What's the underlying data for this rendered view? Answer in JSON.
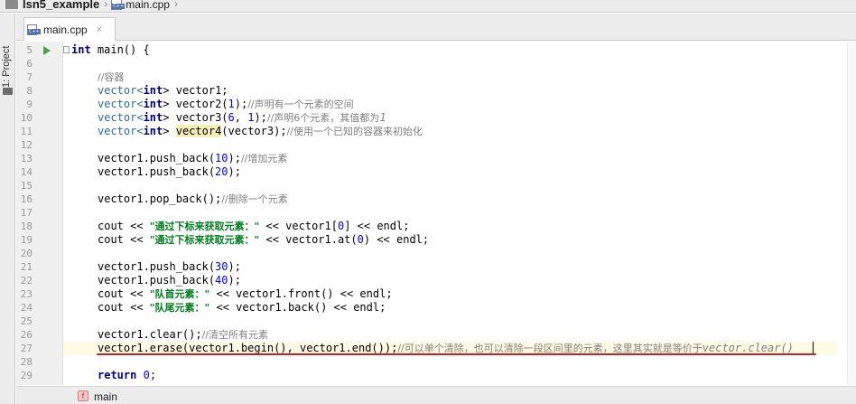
{
  "navbar": {
    "project": "lsn5_example",
    "file": "main.cpp",
    "file_icon_text": "C++"
  },
  "toolstrip": {
    "project_label": "1: Project"
  },
  "tab": {
    "label": "main.cpp",
    "icon_text": "C++",
    "close": "×"
  },
  "editor": {
    "lines": [
      {
        "n": "5"
      },
      {
        "n": "6"
      },
      {
        "n": "7"
      },
      {
        "n": "8"
      },
      {
        "n": "9"
      },
      {
        "n": "10"
      },
      {
        "n": "11"
      },
      {
        "n": "12"
      },
      {
        "n": "13"
      },
      {
        "n": "14"
      },
      {
        "n": "15"
      },
      {
        "n": "16"
      },
      {
        "n": "17"
      },
      {
        "n": "18"
      },
      {
        "n": "19"
      },
      {
        "n": "20"
      },
      {
        "n": "21"
      },
      {
        "n": "22"
      },
      {
        "n": "23"
      },
      {
        "n": "24"
      },
      {
        "n": "25"
      },
      {
        "n": "26"
      },
      {
        "n": "27"
      },
      {
        "n": "28"
      },
      {
        "n": "29"
      }
    ],
    "code": {
      "l5_kw": "int",
      "l5_rest": " main() {",
      "l7_cm": "//容器",
      "l8_a": "vector<",
      "l8_kw": "int",
      "l8_b": "> vector1;",
      "l9_a": "vector<",
      "l9_kw": "int",
      "l9_b": "> vector2(",
      "l9_num": "1",
      "l9_c": ");",
      "l9_cm": "//声明有一个元素的空间",
      "l10_a": "vector<",
      "l10_kw": "int",
      "l10_b": "> vector3(",
      "l10_n1": "6",
      "l10_c": ", ",
      "l10_n2": "1",
      "l10_d": ");",
      "l10_cm": "//声明6个元素，其值都为",
      "l10_cmi": "1",
      "l11_a": "vector<",
      "l11_kw": "int",
      "l11_b": "> ",
      "l11_hl": "vector4",
      "l11_c": "(vector3);",
      "l11_cm": "//使用一个已知的容器来初始化",
      "l13_a": "vector1.push_back(",
      "l13_num": "10",
      "l13_b": ");",
      "l13_cm": "//增加元素",
      "l14_a": "vector1.push_back(",
      "l14_num": "20",
      "l14_b": ");",
      "l16_a": "vector1.pop_back();",
      "l16_cm": "//删除一个元素",
      "l18_a": "cout << ",
      "l18_str": "\"通过下标来获取元素：\"",
      "l18_b": " << vector1[",
      "l18_num": "0",
      "l18_c": "] << endl;",
      "l19_a": "cout << ",
      "l19_str": "\"通过下标来获取元素：\"",
      "l19_b": " << vector1.at(",
      "l19_num": "0",
      "l19_c": ") << endl;",
      "l21_a": "vector1.push_back(",
      "l21_num": "30",
      "l21_b": ");",
      "l22_a": "vector1.push_back(",
      "l22_num": "40",
      "l22_b": ");",
      "l23_a": "cout << ",
      "l23_str": "\"队首元素：\"",
      "l23_b": " << vector1.front() << endl;",
      "l24_a": "cout << ",
      "l24_str": "\"队尾元素：\"",
      "l24_b": " << vector1.back() << endl;",
      "l26_a": "vector1.clear();",
      "l26_cm": "//清空所有元素",
      "l27_a": "vector1.erase(vector1.begin(), vector1.end());",
      "l27_cm": "//可以单个清除，也可以清除一段区间里的元素，这里其实就是等价于",
      "l27_cmi": "vector.clear()",
      "l29_kw": "return",
      "l29_num": "0",
      "l29_b": ";"
    }
  },
  "bottombar": {
    "fn_icon": "f",
    "fn_label": "main"
  },
  "colors": {
    "keyword": "#000080",
    "string": "#007f1f",
    "number": "#0000ff",
    "comment": "#808080",
    "annotation": "#d22020"
  }
}
